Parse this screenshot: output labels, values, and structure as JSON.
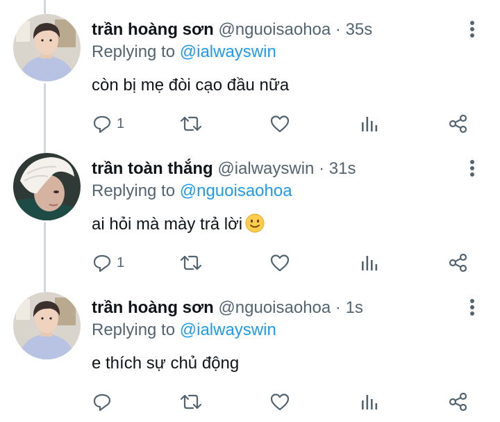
{
  "tweets": [
    {
      "name": "trần hoàng sơn",
      "handle": "@nguoisaohoa",
      "separator": "·",
      "time": "35s",
      "replying_prefix": "Replying to",
      "replying_to": "@ialwayswin",
      "text": "còn bị mẹ đòi cạo đầu nữa",
      "reply_count": "1",
      "avatar": "avatar-boy-hoodie",
      "emoji": ""
    },
    {
      "name": "trần toàn thắng",
      "handle": "@ialwayswin",
      "separator": "·",
      "time": "31s",
      "replying_prefix": "Replying to",
      "replying_to": "@nguoisaohoa",
      "text": "ai hỏi mà mày trả lời",
      "reply_count": "1",
      "avatar": "avatar-white-hair",
      "emoji": "slightly-smiling-face"
    },
    {
      "name": "trần hoàng sơn",
      "handle": "@nguoisaohoa",
      "separator": "·",
      "time": "1s",
      "replying_prefix": "Replying to",
      "replying_to": "@ialwayswin",
      "text": "e thích sự chủ động",
      "reply_count": "",
      "avatar": "avatar-boy-hoodie",
      "emoji": ""
    }
  ],
  "icons": {
    "reply": "reply-icon",
    "retweet": "retweet-icon",
    "like": "heart-icon",
    "stats": "analytics-icon",
    "share": "share-icon",
    "more": "more-vertical-icon"
  },
  "colors": {
    "text": "#0f1419",
    "secondary": "#536471",
    "accent": "#1d9bf0",
    "thread_line": "#cfd9de"
  }
}
